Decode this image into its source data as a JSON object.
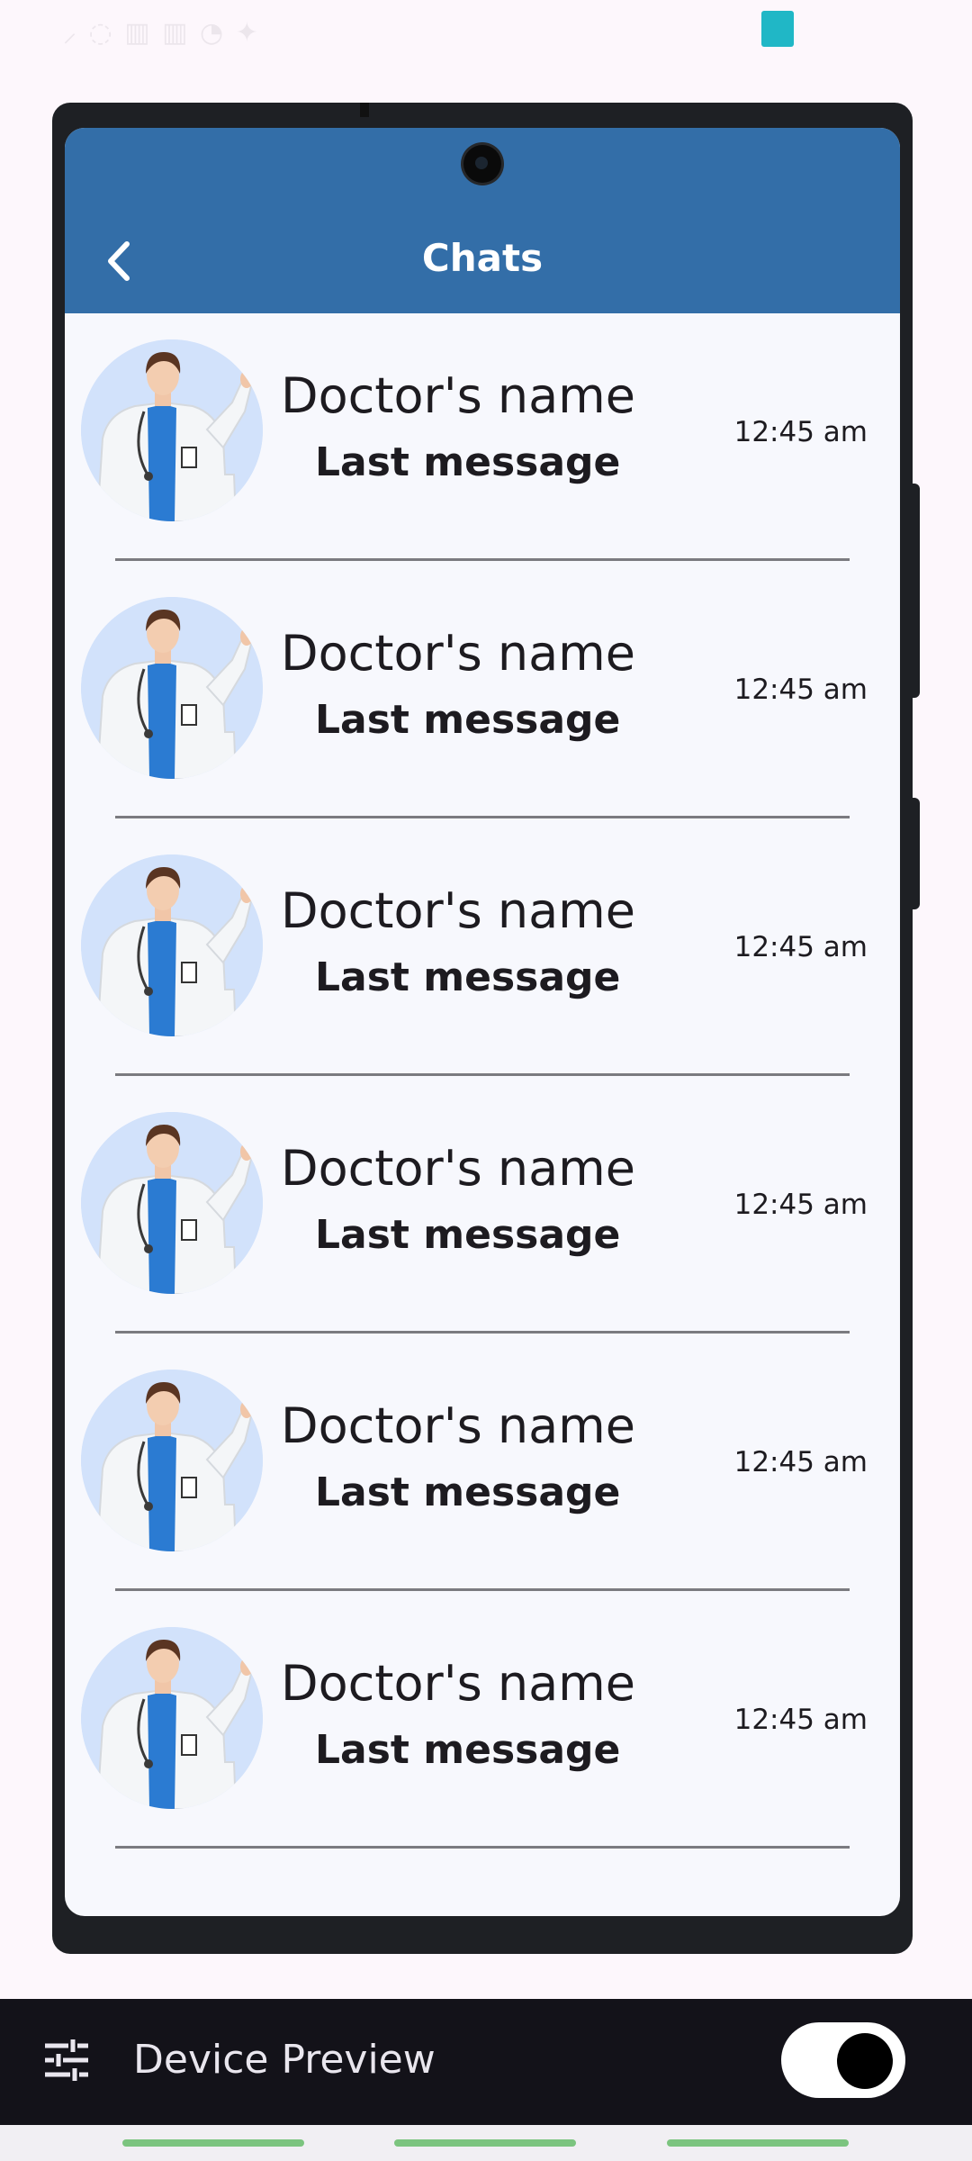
{
  "status_bar": {
    "left_text": "⸝ ◌ ▥ ▥ ◔ ✦",
    "right_text": "◐ ◉ ▣ ◷ ◈ ▯ ⋯ ▤"
  },
  "app_bar": {
    "title": "Chats",
    "color": "#336ea8"
  },
  "chats": [
    {
      "name": "Doctor's name",
      "message": "Last message",
      "time": "12:45 am"
    },
    {
      "name": "Doctor's name",
      "message": "Last message",
      "time": "12:45 am"
    },
    {
      "name": "Doctor's name",
      "message": "Last message",
      "time": "12:45 am"
    },
    {
      "name": "Doctor's name",
      "message": "Last message",
      "time": "12:45 am"
    },
    {
      "name": "Doctor's name",
      "message": "Last message",
      "time": "12:45 am"
    },
    {
      "name": "Doctor's name",
      "message": "Last message",
      "time": "12:45 am"
    }
  ],
  "device_preview": {
    "label": "Device Preview",
    "toggle_on": true,
    "icon": "tune-icon"
  }
}
